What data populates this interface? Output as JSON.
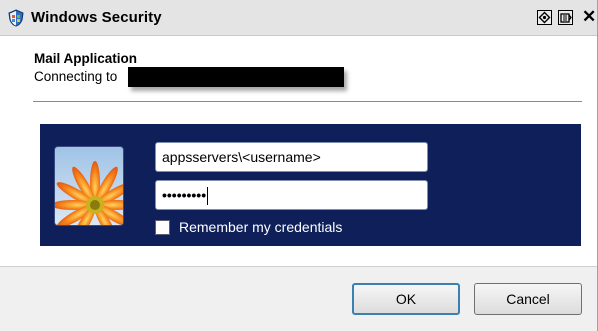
{
  "window": {
    "title": "Windows Security",
    "close_glyph": "✕"
  },
  "dialog": {
    "app_name": "Mail Application",
    "connecting_label": "Connecting to",
    "redacted_server": ""
  },
  "credentials": {
    "username_value": "appsservers\\<username>",
    "password_mask": "•••••••••",
    "remember_label": "Remember my credentials",
    "remember_checked": false,
    "panel_color": "#0e1f5a"
  },
  "buttons": {
    "ok_label": "OK",
    "cancel_label": "Cancel"
  },
  "icons": {
    "title_icon": "windows-security-shield-icon",
    "user_tile": "orange-flower-user-tile",
    "help_icon": "help-icon",
    "restore_icon": "restore-icon",
    "close_icon": "close-icon"
  }
}
